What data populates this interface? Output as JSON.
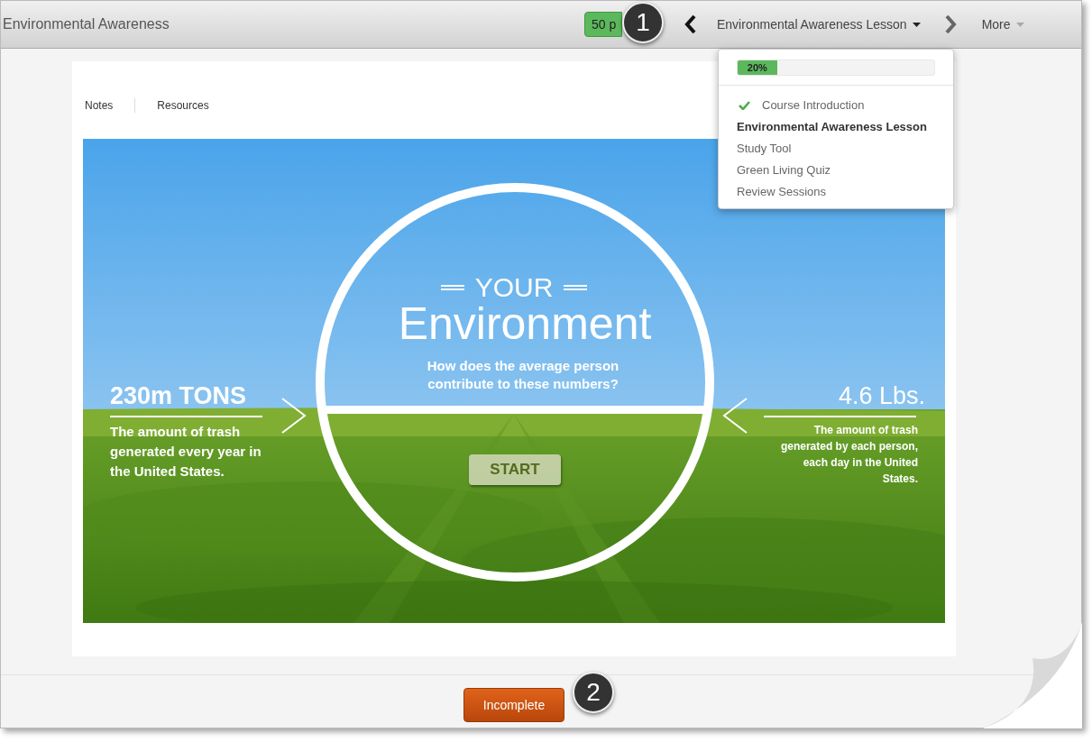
{
  "header": {
    "title": "Environmental Awareness",
    "points_button": "50 p",
    "lesson_menu": "Environmental Awareness Lesson",
    "more": "More"
  },
  "dropdown": {
    "progress": {
      "level": 0.2,
      "label": "20%"
    },
    "items": [
      {
        "label": "Course Introduction",
        "completed": true,
        "selected": false
      },
      {
        "label": "Environmental Awareness Lesson",
        "completed": false,
        "selected": true
      },
      {
        "label": "Study Tool",
        "completed": false,
        "selected": false
      },
      {
        "label": "Green Living Quiz",
        "completed": false,
        "selected": false
      },
      {
        "label": "Review Sessions",
        "completed": false,
        "selected": false
      }
    ]
  },
  "tabs": [
    "Notes",
    "Resources"
  ],
  "slide": {
    "kicker": "YOUR",
    "title": "Environment",
    "question": "How does the average person contribute to these numbers?",
    "start": "START",
    "left_stat": {
      "value": "230m TONS",
      "caption": "The amount of trash generated every year in the United States."
    },
    "right_stat": {
      "value": "4.6 Lbs.",
      "caption": "The amount of trash generated by each  person, each day in the United States."
    }
  },
  "footer": {
    "status_button": "Incomplete"
  },
  "callouts": [
    "1",
    "2"
  ]
}
